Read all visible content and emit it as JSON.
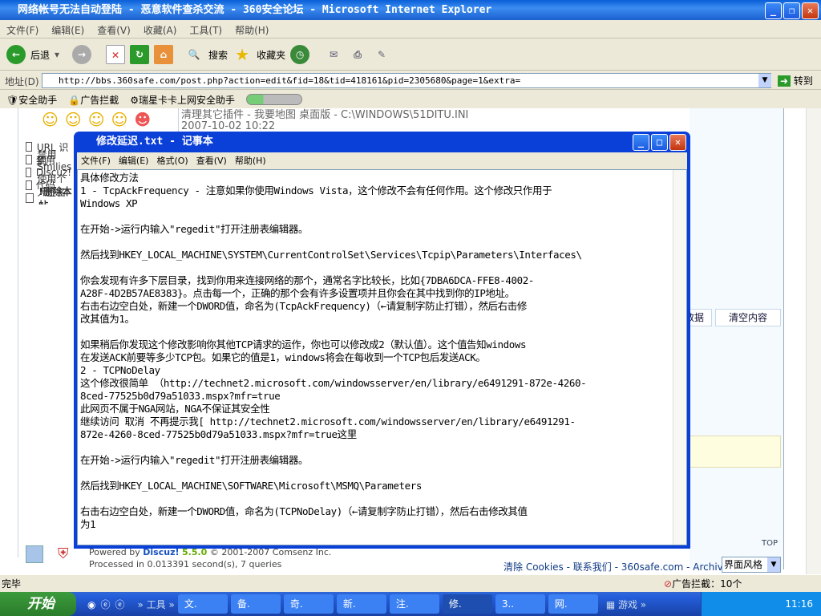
{
  "ie": {
    "title": "网络帐号无法自动登陆 - 恶意软件查杀交流 - 360安全论坛 - Microsoft Internet Explorer",
    "menu": [
      "文件(F)",
      "编辑(E)",
      "查看(V)",
      "收藏(A)",
      "工具(T)",
      "帮助(H)"
    ],
    "toolbar": {
      "back": "后退",
      "search": "搜索",
      "favorites": "收藏夹"
    },
    "address_label": "地址(D)",
    "address": "http://bbs.360safe.com/post.php?action=edit&fid=18&tid=418161&pid=2305680&page=1&extra=",
    "go": "转到",
    "links": [
      "安全助手",
      "广告拦截",
      "瑞星卡卡上网安全助手"
    ],
    "status": "完毕",
    "adblock": "广告拦截：10个"
  },
  "page": {
    "plugin_line": "清理其它插件 - 我要地图 桌面版 - C:\\WINDOWS\\51DITU.INI",
    "date": "2007-10-02 10:22",
    "options": [
      "禁用 URL 识别",
      "禁用 Smilies",
      "禁用 Discuz!代码",
      "使用个人签名",
      "!删除本帖"
    ],
    "btn_data": "恢复数据",
    "btn_clear": "清空内容",
    "powered": "Powered by",
    "discuz": "Discuz!",
    "version": "5.5.0",
    "copyright": "© 2001-2007 Comsenz Inc.",
    "processed": "Processed in 0.013391 second(s), 7 queries",
    "footer_links": "清除 Cookies - 联系我们 - 360safe.com - Archiver",
    "style_select": "界面风格",
    "top": "TOP"
  },
  "notepad": {
    "title": "修改延迟.txt - 记事本",
    "menu": [
      "文件(F)",
      "编辑(E)",
      "格式(O)",
      "查看(V)",
      "帮助(H)"
    ],
    "lines": [
      "具体修改方法",
      "1 - TcpAckFrequency - 注意如果你使用Windows Vista，这个修改不会有任何作用。这个修改只作用于",
      "Windows XP",
      "",
      "在开始->运行内输入\"regedit\"打开注册表编辑器。",
      "",
      "然后找到HKEY_LOCAL_MACHINE\\SYSTEM\\CurrentControlSet\\Services\\Tcpip\\Parameters\\Interfaces\\",
      "",
      "你会发现有许多下层目录，找到你用来连接网络的那个，通常名字比较长，比如{7DBA6DCA-FFE8-4002-",
      "A28F-4D2B57AE8383}。点击每一个，正确的那个会有许多设置项并且你会在其中找到你的IP地址。",
      "右击右边空白处，新建一个DWORD值，命名为(TcpAckFrequency)（←请复制字防止打错），然后右击修",
      "改其值为1。",
      "",
      "如果稍后你发现这个修改影响你其他TCP请求的运作，你也可以修改成2（默认值）。这个值告知windows",
      "在发送ACK前要等多少TCP包。如果它的值是1，windows将会在每收到一个TCP包后发送ACK。",
      "2 - TCPNoDelay",
      "这个修改很简单 （http://technet2.microsoft.com/windowsserver/en/library/e6491291-872e-4260-",
      "8ced-77525b0d79a51033.mspx?mfr=true",
      "此网页不属于NGA网站，NGA不保证其安全性",
      "继续访问 取消 不再提示我[ http://technet2.microsoft.com/windowsserver/en/library/e6491291-",
      "872e-4260-8ced-77525b0d79a51033.mspx?mfr=true这里",
      "",
      "在开始->运行内输入\"regedit\"打开注册表编辑器。",
      "",
      "然后找到HKEY_LOCAL_MACHINE\\SOFTWARE\\Microsoft\\MSMQ\\Parameters",
      "",
      "右击右边空白处，新建一个DWORD值，命名为(TCPNoDelay)（←请复制字防止打错），然后右击修改其值",
      "为1"
    ]
  },
  "taskbar": {
    "start": "开始",
    "toolbar_label": "工具",
    "tasks": [
      "文.",
      "备.",
      "奇.",
      "新.",
      "注.",
      "修.",
      "3..",
      "网."
    ],
    "games": "游戏",
    "clock": "11:16"
  }
}
